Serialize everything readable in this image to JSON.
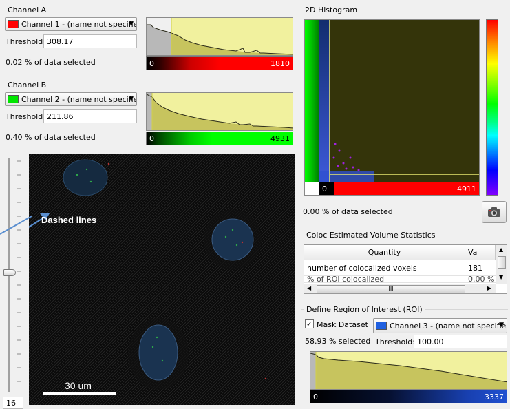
{
  "channel_a": {
    "title": "Channel A",
    "channel_name": "Channel 1 - (name not specifie",
    "swatch_color": "#ff0000",
    "threshold_label": "Threshold:",
    "threshold_value": "308.17",
    "selected_text": "0.02 % of data selected",
    "bar_min": "0",
    "bar_max": "1810"
  },
  "channel_b": {
    "title": "Channel B",
    "channel_name": "Channel 2 - (name not specifie",
    "swatch_color": "#00e600",
    "threshold_label": "Threshold:",
    "threshold_value": "211.86",
    "selected_text": "0.40 % of data selected",
    "bar_min": "0",
    "bar_max": "4931"
  },
  "histogram_2d": {
    "title": "2D Histogram",
    "bar_min": "0",
    "bar_max": "4911",
    "selected_text": "0.00 % of data selected",
    "snapshot_icon": "camera-icon"
  },
  "viewer": {
    "annotation": "Dashed lines",
    "scale_label": "30 um",
    "slice_value": "16"
  },
  "coloc_stats": {
    "title": "Coloc Estimated Volume Statistics",
    "columns": [
      "Quantity",
      "Va"
    ],
    "rows": [
      {
        "quantity": "number of colocalized voxels",
        "value": "181"
      },
      {
        "quantity": "% of ROI colocalized",
        "value": "0.00 %"
      }
    ],
    "scroll_marker": "III"
  },
  "roi": {
    "title": "Define Region of Interest (ROI)",
    "mask_label": "Mask Dataset",
    "mask_checked": true,
    "selected_text": "58.93 % selected",
    "channel_name": "Channel 3 - (name not specifie",
    "swatch_color": "#2060e0",
    "threshold_label": "Threshold:",
    "threshold_value": "100.00",
    "bar_min": "0",
    "bar_max": "3337"
  }
}
